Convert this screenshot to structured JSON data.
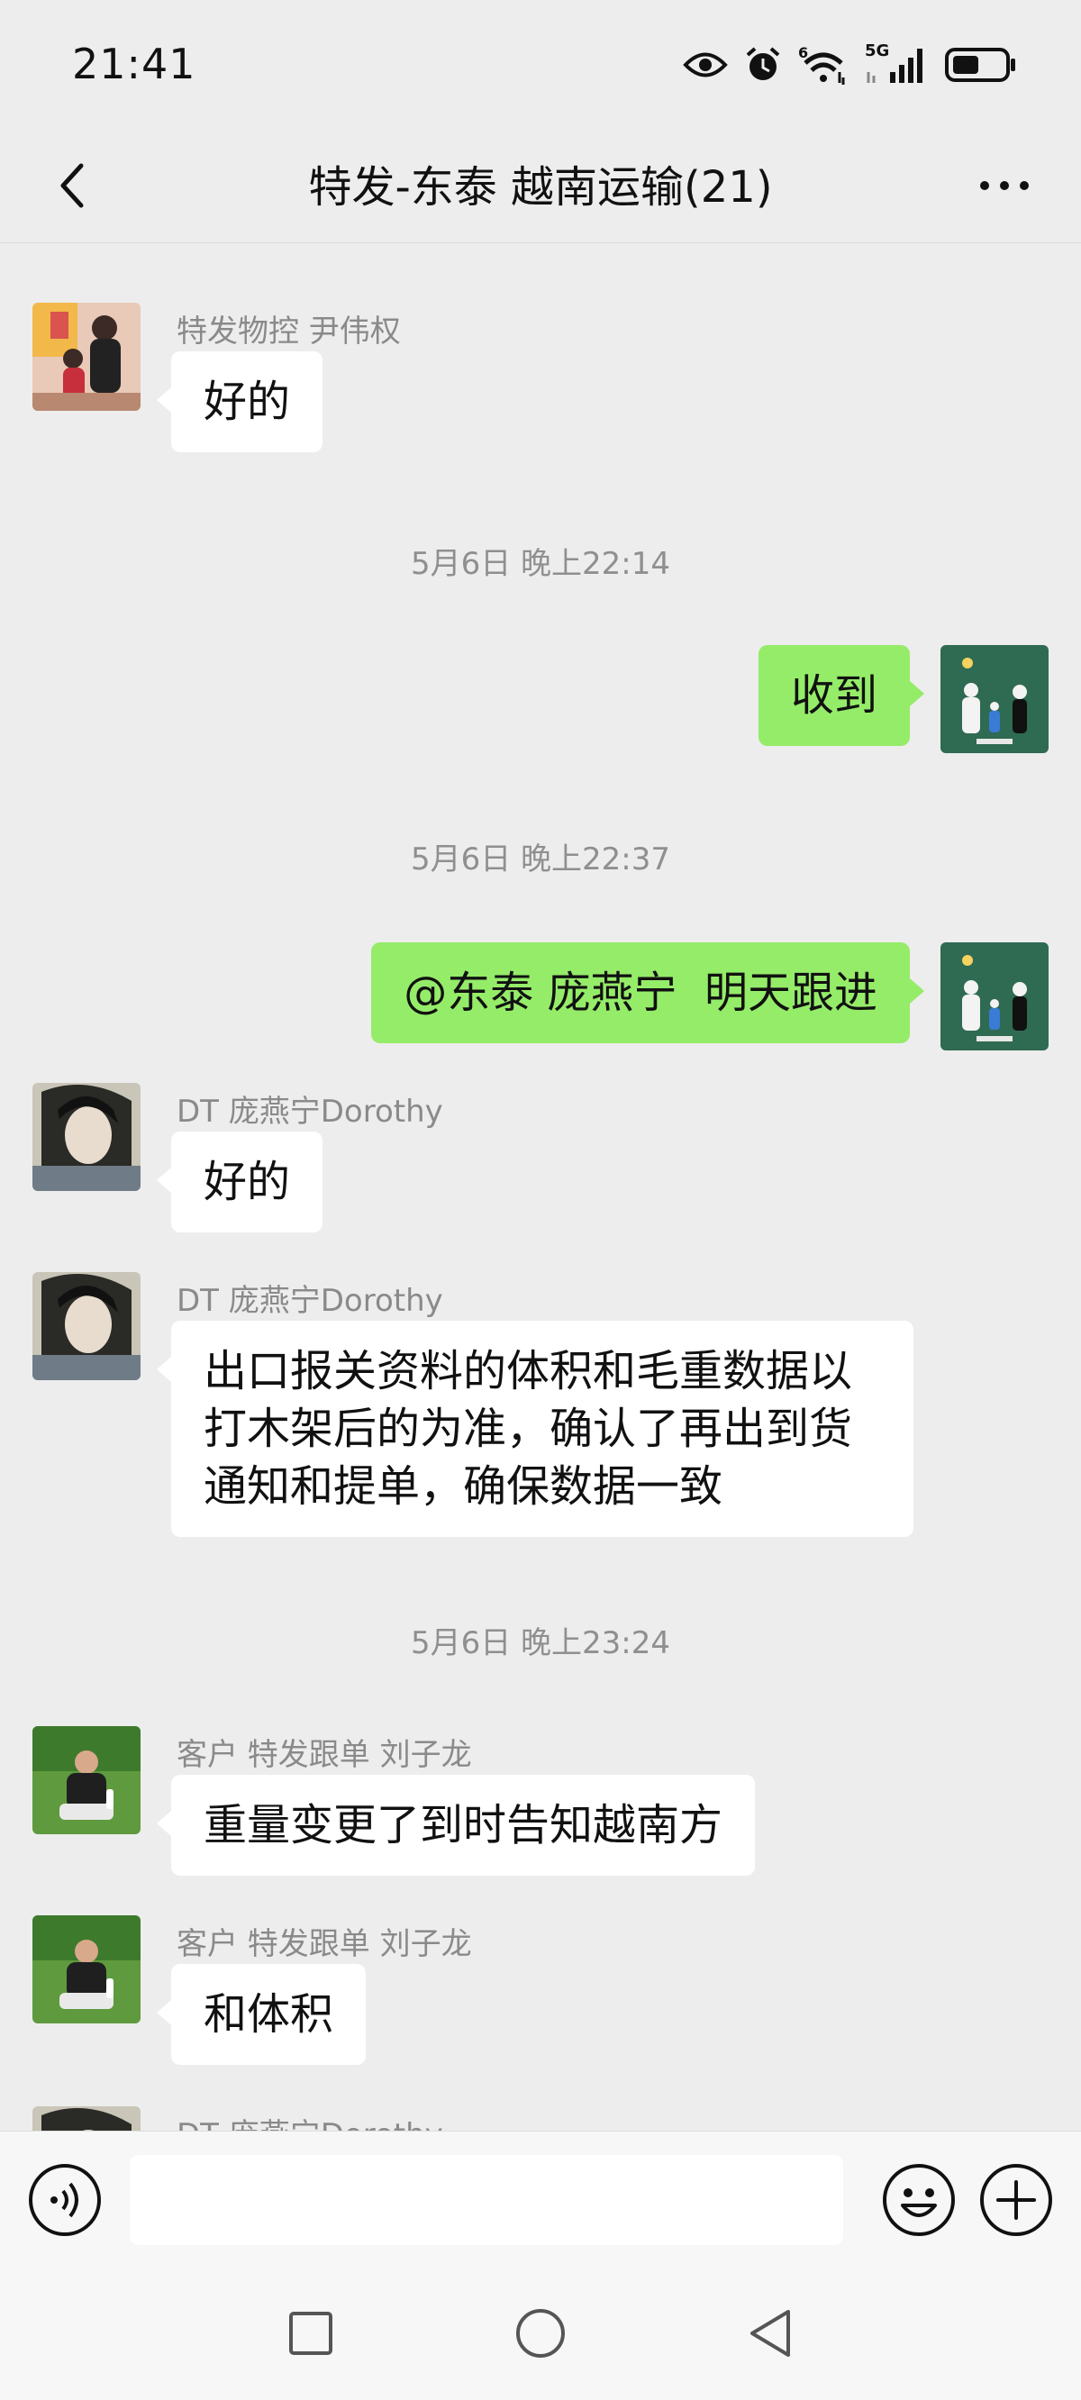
{
  "status_bar": {
    "time": "21:41",
    "network_label": "5G",
    "sim_label": "6",
    "icons": [
      "eye-icon",
      "alarm-icon",
      "wifi-icon",
      "signal-icon",
      "battery-icon"
    ]
  },
  "header": {
    "title": "特发-东泰 越南运输(21)",
    "back_icon": "chevron-left-icon",
    "more_icon": "more-dots-icon"
  },
  "messages": [
    {
      "type": "in",
      "sender": "特发物控 尹伟权",
      "text": "好的"
    },
    {
      "type": "time",
      "text": "5月6日 晚上22:14"
    },
    {
      "type": "out",
      "text": "收到"
    },
    {
      "type": "time",
      "text": "5月6日 晚上22:37"
    },
    {
      "type": "out",
      "text": "@东泰 庞燕宁  明天跟进"
    },
    {
      "type": "in",
      "sender": "DT 庞燕宁Dorothy",
      "text": "好的"
    },
    {
      "type": "in",
      "sender": "DT 庞燕宁Dorothy",
      "lines": [
        "出口报关资料的体积和毛重数据以",
        "打木架后的为准，确认了再出到货",
        "通知和提单，确保数据一致"
      ]
    },
    {
      "type": "time",
      "text": "5月6日 晚上23:24"
    },
    {
      "type": "in",
      "sender": "客户 特发跟单 刘子龙",
      "text": "重量变更了到时告知越南方"
    },
    {
      "type": "in",
      "sender": "客户 特发跟单 刘子龙",
      "text": "和体积"
    },
    {
      "type": "in",
      "sender": "DT 庞燕宁Dorothy",
      "text": ""
    }
  ],
  "input_bar": {
    "placeholder": "",
    "voice_icon": "voice-icon",
    "emoji_icon": "emoji-icon",
    "plus_icon": "plus-icon"
  },
  "nav_bar": {
    "icons": [
      "recent-apps-icon",
      "home-icon",
      "back-icon"
    ]
  },
  "colors": {
    "background": "#ededed",
    "outgoing_bubble": "#95ec69",
    "incoming_bubble": "#ffffff",
    "meta_text": "#8a8a8a"
  }
}
